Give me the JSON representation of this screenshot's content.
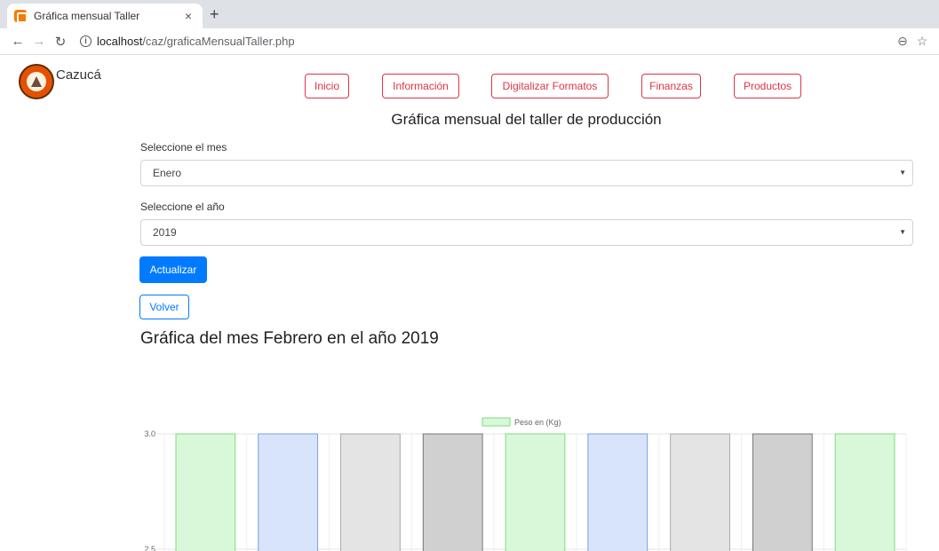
{
  "browser": {
    "tab_title": "Gráfica mensual Taller",
    "tab_close": "×",
    "new_tab": "+",
    "url_host": "localhost",
    "url_path": "/caz/graficaMensualTaller.php"
  },
  "brand": {
    "name": "Cazucá"
  },
  "nav": {
    "items": [
      "Inicio",
      "Información",
      "Digitalizar Formatos",
      "Finanzas",
      "Productos"
    ],
    "color": "#dc3545"
  },
  "page_title": "Gráfica mensual del taller de producción",
  "form": {
    "month_label": "Seleccione el mes",
    "month_value": "Enero",
    "year_label": "Seleccione el año",
    "year_value": "2019",
    "update_button": "Actualizar",
    "back_button": "Volver"
  },
  "chart_heading": "Gráfica del mes Febrero en el año 2019",
  "chart_data": {
    "type": "bar",
    "legend": "Peso en (Kg)",
    "values": [
      3,
      3,
      3,
      3,
      3,
      3,
      3,
      3,
      3
    ],
    "colors": [
      {
        "fill": "#d9f7d9",
        "stroke": "#7cde7c"
      },
      {
        "fill": "#d8e4fa",
        "stroke": "#7a9ee6"
      },
      {
        "fill": "#e4e4e4",
        "stroke": "#aaaaaa"
      },
      {
        "fill": "#d0d0d0",
        "stroke": "#777777"
      },
      {
        "fill": "#d9f7d9",
        "stroke": "#7cde7c"
      },
      {
        "fill": "#d8e4fa",
        "stroke": "#7a9ee6"
      },
      {
        "fill": "#e4e4e4",
        "stroke": "#aaaaaa"
      },
      {
        "fill": "#d0d0d0",
        "stroke": "#777777"
      },
      {
        "fill": "#d9f7d9",
        "stroke": "#7cde7c"
      }
    ],
    "y_ticks": [
      "3.0",
      "2.5"
    ],
    "y_tick_values": [
      3.0,
      2.5
    ],
    "grid": true
  }
}
